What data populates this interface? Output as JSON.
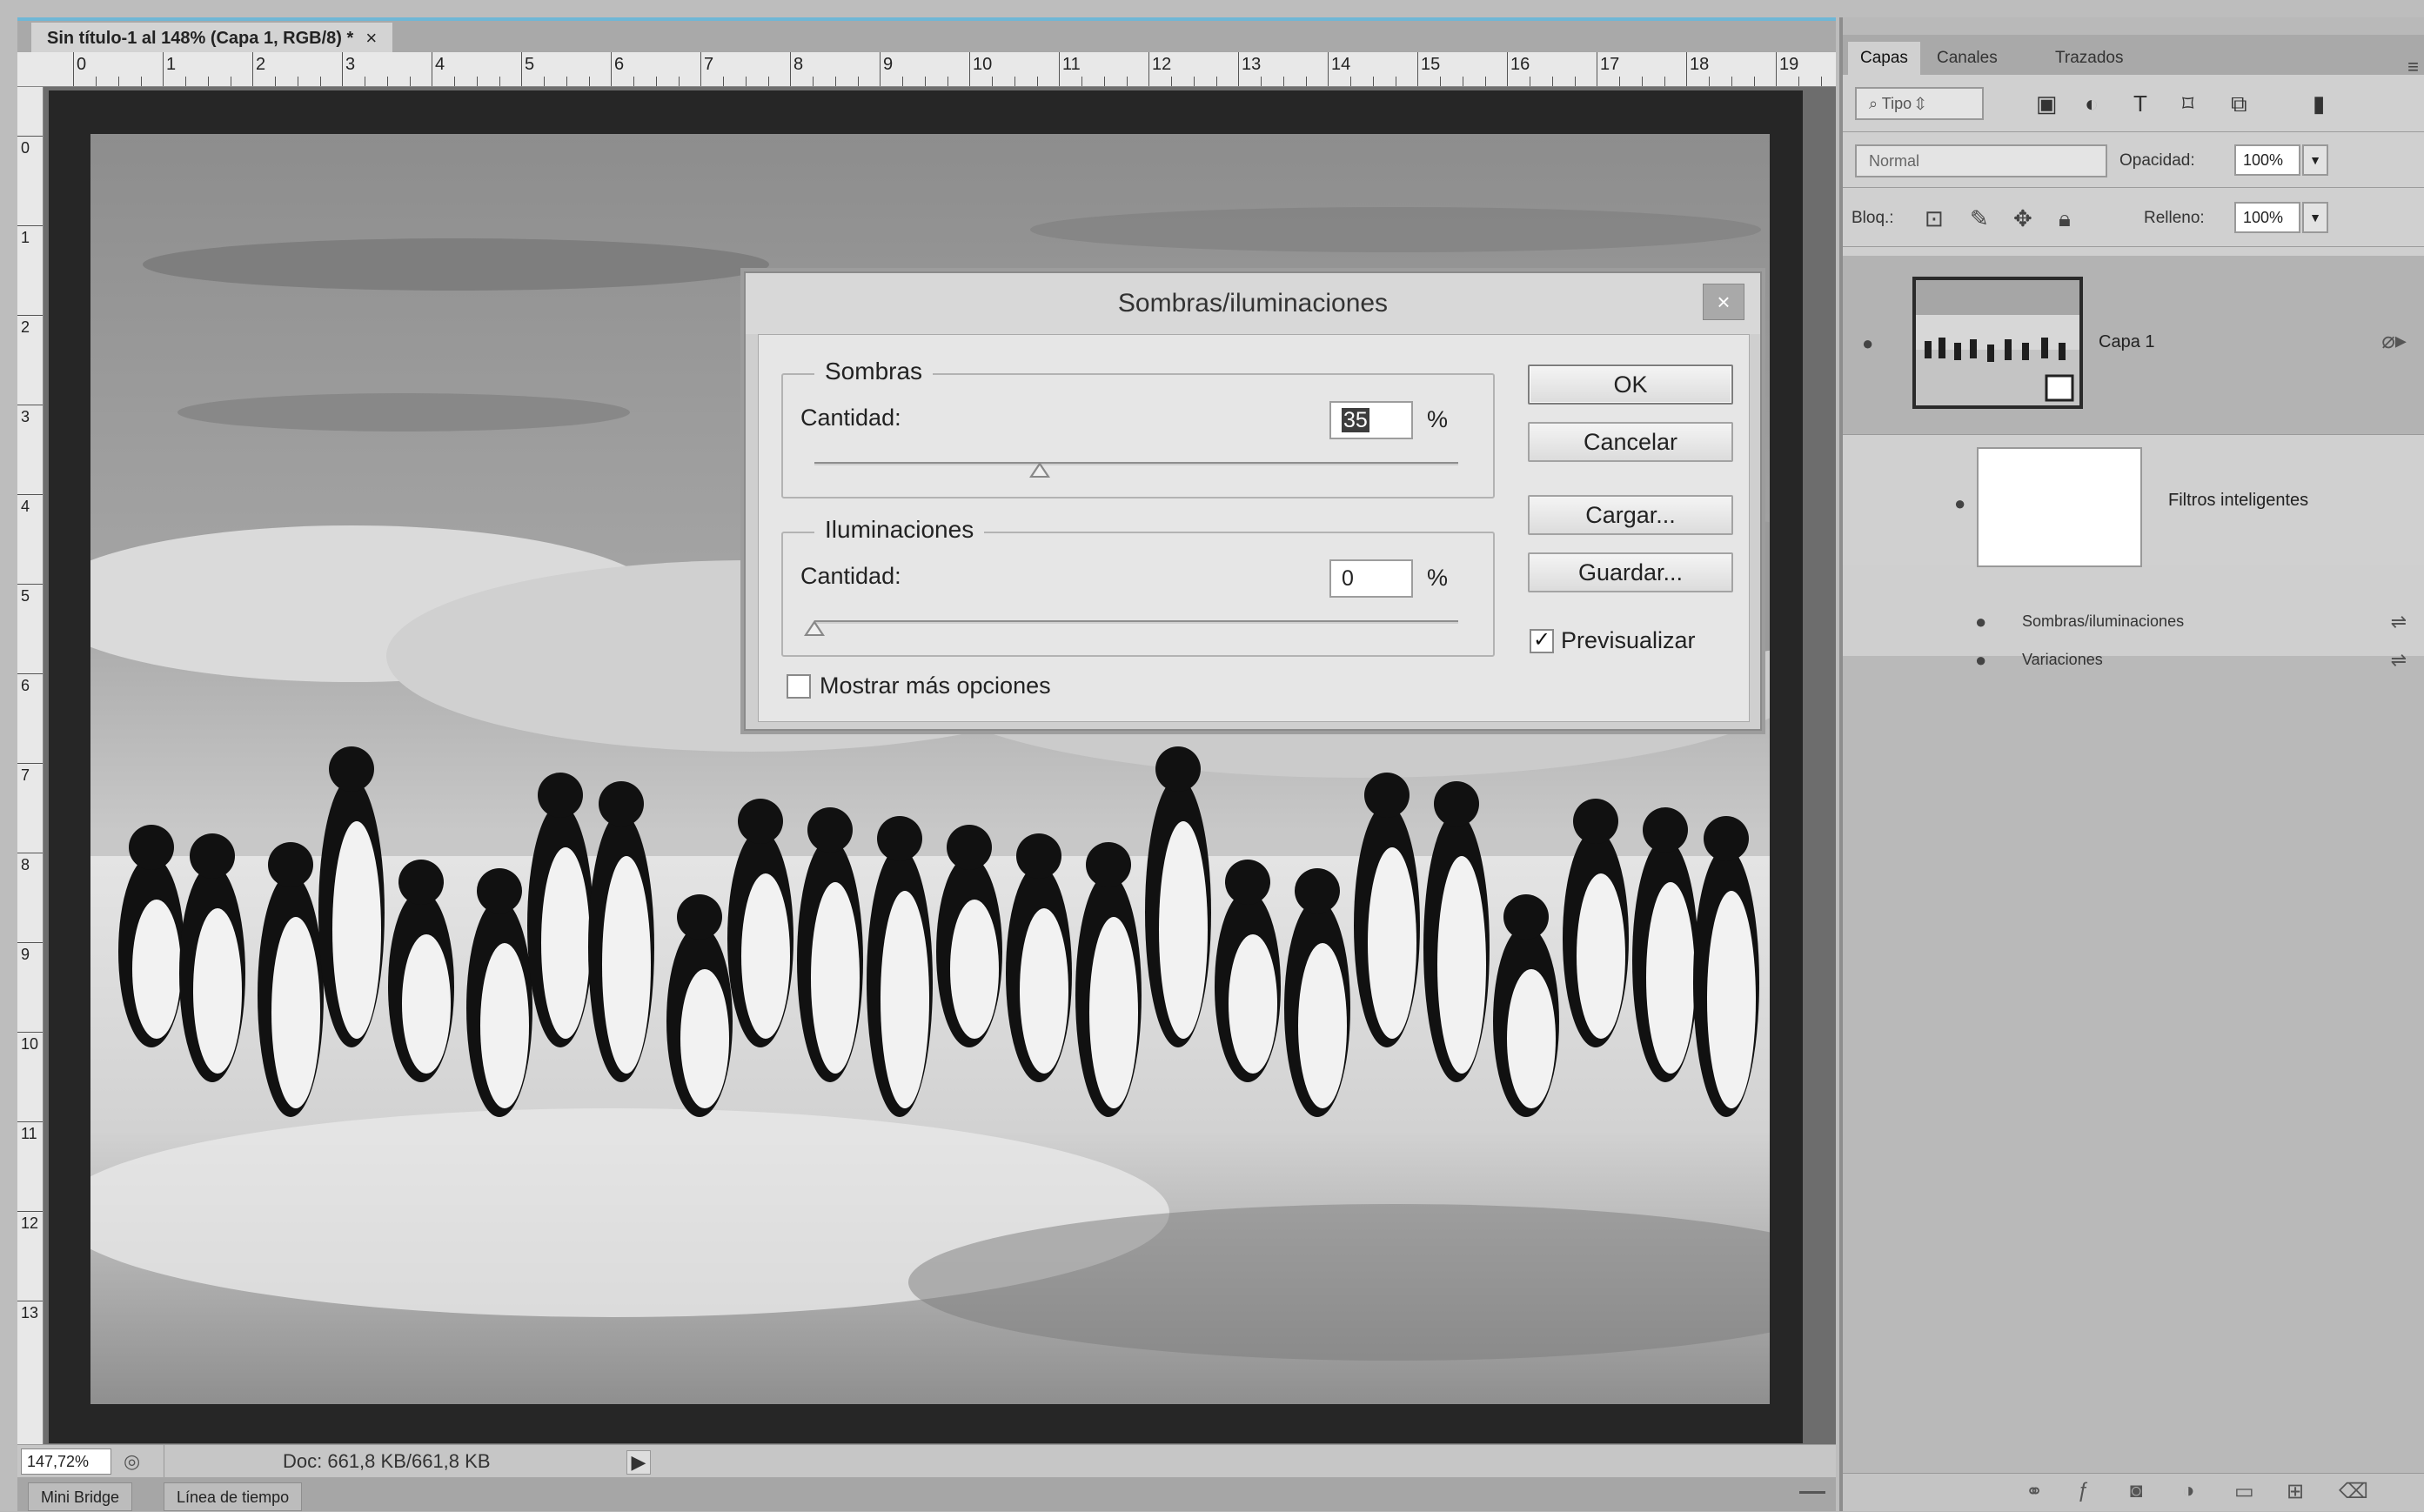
{
  "document": {
    "tab_title": "Sin título-1 al 148% (Capa 1, RGB/8) *",
    "tab_close": "×"
  },
  "rulers": {
    "horizontal": [
      "0",
      "1",
      "2",
      "3",
      "4",
      "5",
      "6",
      "7",
      "8",
      "9",
      "10",
      "11",
      "12",
      "13",
      "14",
      "15",
      "16",
      "17",
      "18",
      "19"
    ],
    "vertical": [
      "0",
      "1",
      "2",
      "3",
      "4",
      "5",
      "6",
      "7",
      "8",
      "9",
      "10",
      "11",
      "12",
      "13"
    ]
  },
  "dialog": {
    "title": "Sombras/iluminaciones",
    "close": "×",
    "shadows": {
      "group_label": "Sombras",
      "amount_label": "Cantidad:",
      "amount_value": "35",
      "unit": "%",
      "slider_fraction": 0.35
    },
    "highlights": {
      "group_label": "Iluminaciones",
      "amount_label": "Cantidad:",
      "amount_value": "0",
      "unit": "%",
      "slider_fraction": 0
    },
    "buttons": {
      "ok": "OK",
      "cancel": "Cancelar",
      "load": "Cargar...",
      "save": "Guardar..."
    },
    "preview_label": "Previsualizar",
    "preview_checked": true,
    "more_options_label": "Mostrar más opciones",
    "more_options_checked": false
  },
  "status": {
    "zoom": "147,72%",
    "doc_info": "Doc: 661,8 KB/661,8 KB",
    "arrow": "▶"
  },
  "bottom_tabs": [
    "Mini Bridge",
    "Línea de tiempo"
  ],
  "panel": {
    "tabs": [
      "Capas",
      "Canales",
      "Trazados"
    ],
    "filter_kind": "Tipo",
    "blend_mode": "Normal",
    "opacity_label": "Opacidad:",
    "opacity_value": "100%",
    "lock_label": "Bloq.:",
    "fill_label": "Relleno:",
    "fill_value": "100%",
    "layer_name": "Capa 1",
    "smart_filters_label": "Filtros inteligentes",
    "filters": [
      "Sombras/iluminaciones",
      "Variaciones"
    ]
  },
  "icons": {
    "search": "⌕",
    "eye": "●",
    "check": "✓"
  }
}
